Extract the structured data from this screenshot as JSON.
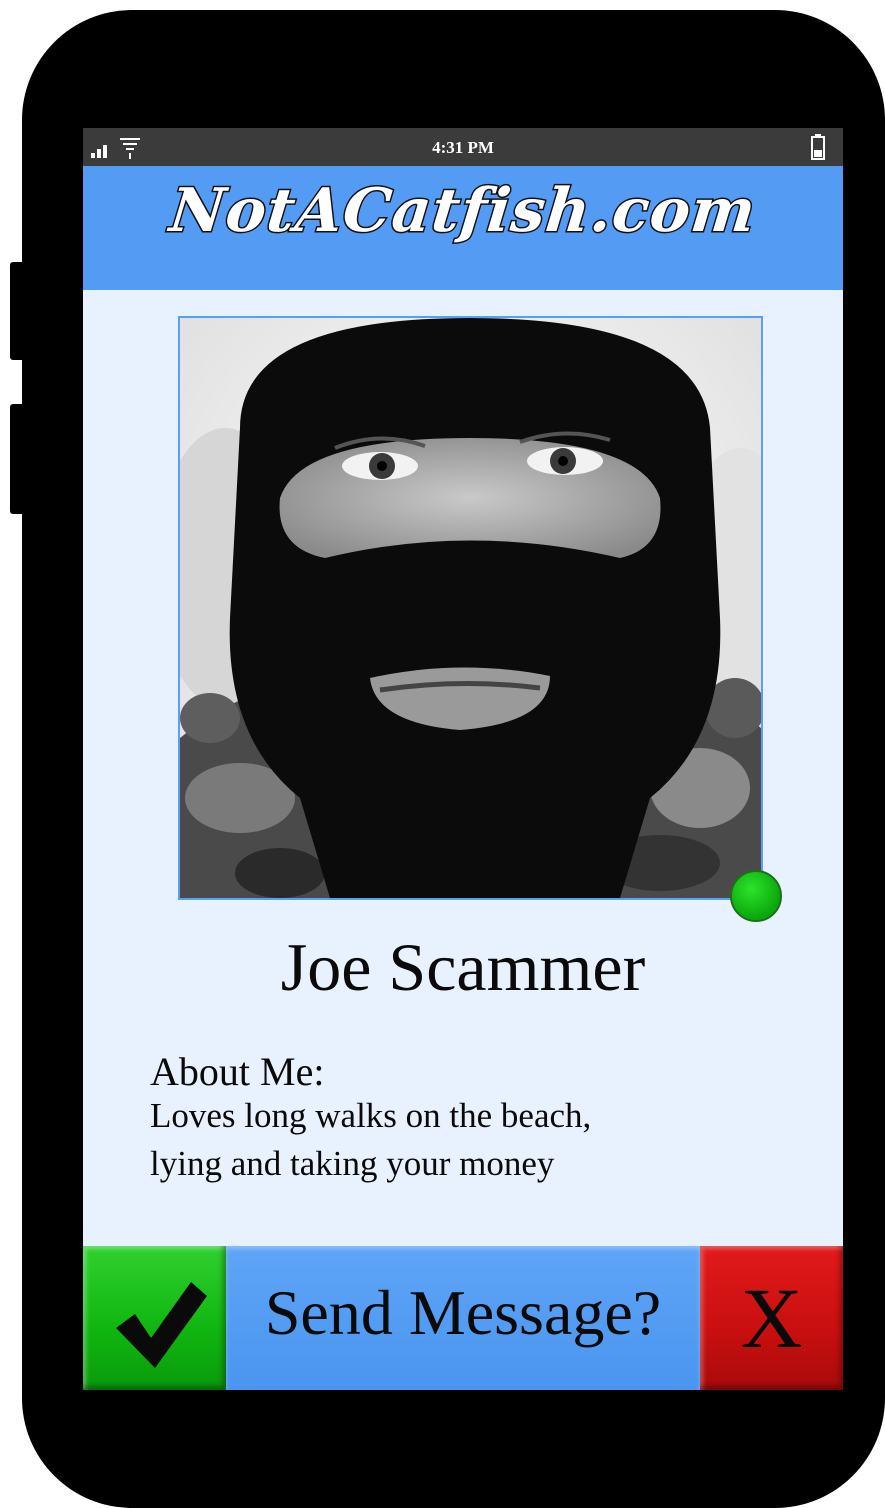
{
  "status_bar": {
    "time": "4:31 PM",
    "signal_icon": "signal-bars-icon",
    "wifi_icon": "wifi-icon",
    "battery_icon": "battery-icon"
  },
  "header": {
    "site_title": "NotACatfish.com",
    "background_color": "#549bf4"
  },
  "profile": {
    "photo_description_icon": "profile-photo",
    "online_status_color": "#11c211",
    "name": "Joe Scammer",
    "about_heading": "About Me:",
    "about_lines": [
      "Loves long walks on the beach,",
      "lying and taking your money"
    ]
  },
  "actions": {
    "accept_icon": "checkmark-icon",
    "accept_color": "#11b811",
    "send_label": "Send Message?",
    "send_color": "#4a95f0",
    "reject_label": "X",
    "reject_color": "#c81010"
  },
  "colors": {
    "screen_background": "#e8f1fe",
    "phone_body": "#000000"
  }
}
